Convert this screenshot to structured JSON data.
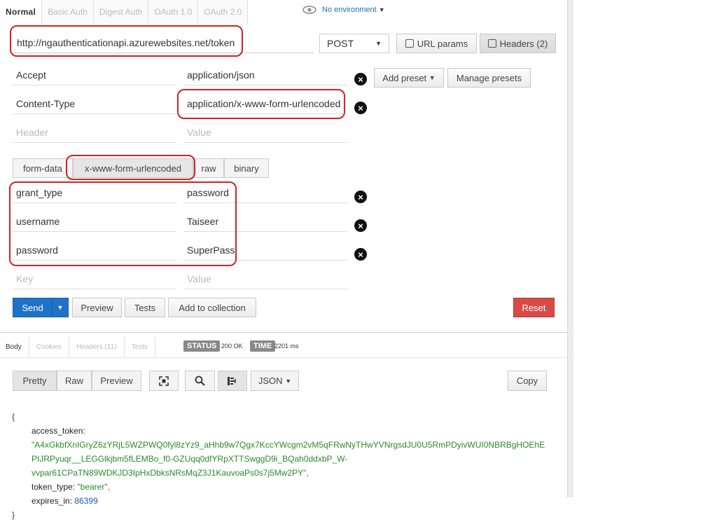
{
  "auth_tabs": [
    "Normal",
    "Basic Auth",
    "Digest Auth",
    "OAuth 1.0",
    "OAuth 2.0"
  ],
  "environment": "No environment",
  "request": {
    "url": "http://ngauthenticationapi.azurewebsites.net/token",
    "method": "POST",
    "url_params_label": "URL params",
    "headers_label": "Headers (2)"
  },
  "headers": [
    {
      "key": "Accept",
      "value": "application/json"
    },
    {
      "key": "Content-Type",
      "value": "application/x-www-form-urlencoded"
    }
  ],
  "header_placeholders": {
    "key": "Header",
    "value": "Value"
  },
  "preset_buttons": {
    "add": "Add preset",
    "manage": "Manage presets"
  },
  "body_tabs": [
    "form-data",
    "x-www-form-urlencoded",
    "raw",
    "binary"
  ],
  "body_params": [
    {
      "key": "grant_type",
      "value": "password"
    },
    {
      "key": "username",
      "value": "Taiseer"
    },
    {
      "key": "password",
      "value": "SuperPass"
    }
  ],
  "body_placeholders": {
    "key": "Key",
    "value": "Value"
  },
  "actions": {
    "send": "Send",
    "preview": "Preview",
    "tests": "Tests",
    "add_to_collection": "Add to collection",
    "reset": "Reset"
  },
  "response_tabs": [
    "Body",
    "Cookies",
    "Headers (11)",
    "Tests"
  ],
  "status": {
    "label": "STATUS",
    "value": "200 OK"
  },
  "time": {
    "label": "TIME",
    "value": "2201 ms"
  },
  "view_tabs": [
    "Pretty",
    "Raw",
    "Preview"
  ],
  "format": "JSON",
  "copy_label": "Copy",
  "response_json": {
    "open": "{",
    "close": "}",
    "k_access_token": "access_token:",
    "access_token_1": "\"A4xGkbfXnIGryZ6zYRjL5WZPWQ0fyl8zYz9_aHhb9w7Qgx7KccYWcgm2vM5qFRwNyTHwYVNrgsdJU0U5RmPDyivWUI0NBRBgHOEhE",
    "access_token_2": "PIJRPyuqr__LEGGlkjbm5fLEMBo_f0-GZUqq0dfYRpXTTSwggD9i_BQah0ddxbP_W-",
    "access_token_3": "vvpar61CPaTN89WDKJD3IpHxDbksNRsMqZ3J1KauvoaPs0s7j5Mw2PY\",",
    "k_token_type": "token_type:",
    "token_type": "\"bearer\",",
    "k_expires_in": "expires_in:",
    "expires_in": "86399"
  }
}
